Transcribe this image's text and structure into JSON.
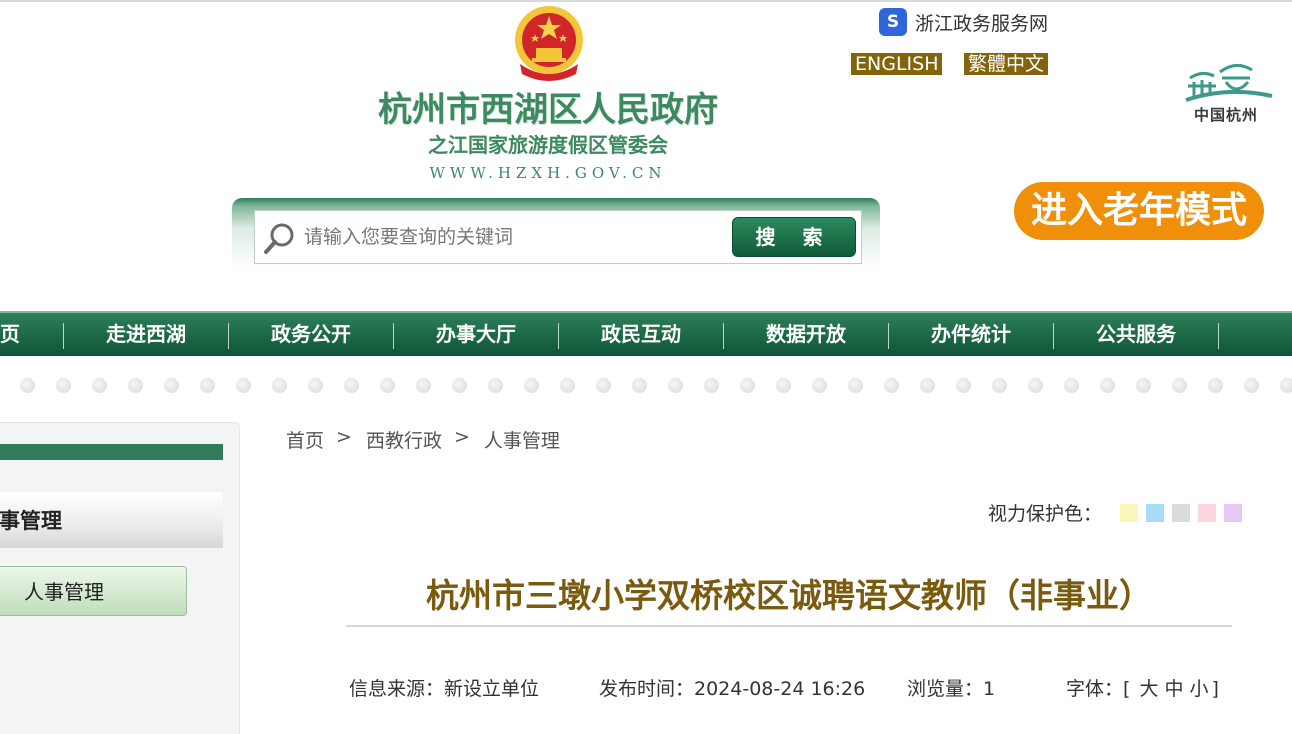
{
  "header": {
    "site_title": "杭州市西湖区人民政府",
    "site_subtitle": "之江国家旅游度假区管委会",
    "site_url": "WWW.HZXH.GOV.CN",
    "zj_link_label": "浙江政务服务网",
    "lang_english": "ENGLISH",
    "lang_traditional": "繁體中文",
    "hz_logo_text": "中国杭州",
    "elder_mode_label": "进入老年模式"
  },
  "search": {
    "placeholder": "请输入您要查询的关键词",
    "button_label": "搜 索"
  },
  "nav": {
    "items": [
      "首页",
      "走进西湖",
      "政务公开",
      "办事大厅",
      "政民互动",
      "数据开放",
      "办件统计",
      "公共服务"
    ]
  },
  "sidebar": {
    "title": "人事管理",
    "items": [
      "人事管理"
    ]
  },
  "breadcrumb": {
    "items": [
      "首页",
      "西教行政",
      "人事管理"
    ],
    "separator": ">"
  },
  "eye_care": {
    "label": "视力保护色：",
    "colors": [
      "#faf5b9",
      "#a6dcf6",
      "#dcdcdc",
      "#fcd4de",
      "#e6c9f9"
    ]
  },
  "article": {
    "title": "杭州市三墩小学双桥校区诚聘语文教师（非事业）",
    "source": "信息来源：新设立单位",
    "publish_time": "发布时间：2024-08-24 16:26",
    "views": "浏览量：1",
    "font_label": "字体：",
    "font_open": "[",
    "font_large": "大",
    "font_medium": "中",
    "font_small": "小",
    "font_close": "]"
  },
  "colors": {
    "brand_green": "#2f7d5a",
    "title_brown": "#7a5a0f",
    "lang_bg": "#83640c",
    "elder_orange": "#f08f0a"
  }
}
